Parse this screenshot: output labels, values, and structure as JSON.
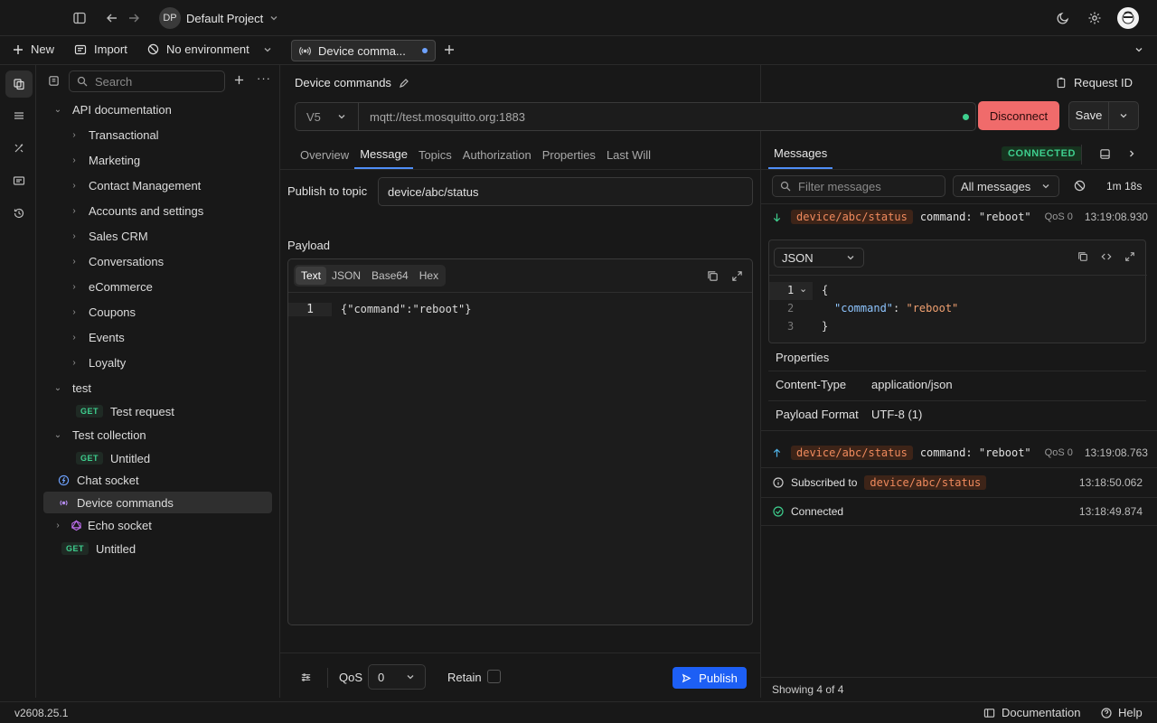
{
  "project": {
    "initials": "DP",
    "name": "Default Project"
  },
  "toolbar": {
    "new_label": "New",
    "import_label": "Import",
    "env_label": "No environment"
  },
  "open_tab": {
    "label": "Device comma..."
  },
  "sidebar": {
    "search_placeholder": "Search",
    "tree": {
      "api_doc": "API documentation",
      "api_children": [
        "Transactional",
        "Marketing",
        "Contact Management",
        "Accounts and settings",
        "Sales CRM",
        "Conversations",
        "eCommerce",
        "Coupons",
        "Events",
        "Loyalty"
      ],
      "test": "test",
      "test_request_method": "GET",
      "test_request": "Test request",
      "test_collection": "Test collection",
      "untitled_method": "GET",
      "untitled": "Untitled",
      "chat_socket": "Chat socket",
      "device_commands": "Device commands",
      "echo_socket": "Echo socket",
      "untitled2_method": "GET",
      "untitled2": "Untitled"
    }
  },
  "request": {
    "title": "Device commands",
    "request_id_label": "Request ID",
    "version": "V5",
    "url": "mqtt://test.mosquitto.org:1883",
    "disconnect_label": "Disconnect",
    "save_label": "Save",
    "tabs": [
      "Overview",
      "Message",
      "Topics",
      "Authorization",
      "Properties",
      "Last Will"
    ],
    "publish_topic_label": "Publish to topic",
    "publish_topic_value": "device/abc/status",
    "payload_label": "Payload",
    "payload_formats": [
      "Text",
      "JSON",
      "Base64",
      "Hex"
    ],
    "payload_line_no": "1",
    "payload_text": "{\"command\":\"reboot\"}",
    "qos_label": "QoS",
    "qos_value": "0",
    "retain_label": "Retain",
    "publish_label": "Publish"
  },
  "messages": {
    "title": "Messages",
    "status": "CONNECTED",
    "filter_placeholder": "Filter messages",
    "filter_select": "All messages",
    "elapsed": "1m 18s",
    "items": [
      {
        "topic": "device/abc/status",
        "preview": "command: \"reboot\"",
        "qos": "QoS 0",
        "time": "13:19:08.930"
      },
      {
        "topic": "device/abc/status",
        "preview": "command: \"reboot\"",
        "qos": "QoS 0",
        "time": "13:19:08.763"
      }
    ],
    "detail": {
      "format": "JSON",
      "lines": [
        "1",
        "2",
        "3"
      ],
      "code_open": "{",
      "code_key": "\"command\"",
      "code_colon": ": ",
      "code_val": "\"reboot\"",
      "code_close": "}",
      "properties_title": "Properties",
      "props": [
        {
          "key": "Content-Type",
          "value": "application/json"
        },
        {
          "key": "Payload Format",
          "value": "UTF-8 (1)"
        }
      ]
    },
    "subscribed_label": "Subscribed to",
    "subscribed_topic": "device/abc/status",
    "subscribed_time": "13:18:50.062",
    "connected_label": "Connected",
    "connected_time": "13:18:49.874",
    "footer": "Showing 4 of 4"
  },
  "statusbar": {
    "version": "v2608.25.1",
    "docs_label": "Documentation",
    "help_label": "Help"
  },
  "colors": {
    "accent": "#4f8ef7",
    "disconnect": "#f06b6b",
    "connected": "#3ecf8e",
    "topic": "#f08a5d",
    "publish": "#1d5ff5"
  }
}
